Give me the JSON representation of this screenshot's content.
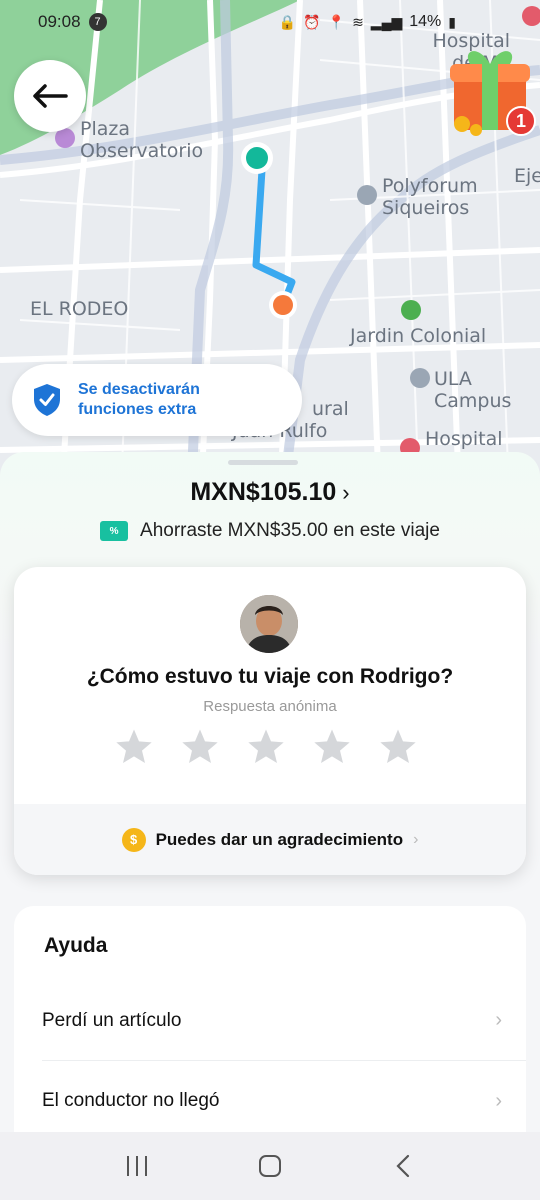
{
  "status_bar": {
    "time": "09:08",
    "notification_count": "7",
    "battery": "14%"
  },
  "map": {
    "labels": {
      "plaza": "Plaza\nObservatorio",
      "polyforum": "Polyforum\nSiqueiros",
      "el_rodeo": "EL RODEO",
      "jardin": "Jardin Colonial",
      "ula": "ULA Campus",
      "hospital_top": "Hospital\nde Mé",
      "hospital_angel": "Hospital Ange",
      "eje": "Eje",
      "cultural": "ural",
      "rulfo": "Juan Rulfo"
    },
    "route_color": "#3aa9f0",
    "origin_color": "#13b89a",
    "destination_color": "#f5793b"
  },
  "gift": {
    "badge": "1"
  },
  "banner": {
    "text": "Se desactivarán\nfunciones extra"
  },
  "trip": {
    "price": "MXN$105.10",
    "price_chevron": "›",
    "savings_icon": "%",
    "savings": "Ahorraste MXN$35.00 en este viaje"
  },
  "rating": {
    "question": "¿Cómo estuvo tu viaje con Rodrigo?",
    "subtitle": "Respuesta anónima",
    "star_count": 5,
    "thanks": "Puedes dar un agradecimiento",
    "thanks_icon": "$"
  },
  "help": {
    "title": "Ayuda",
    "items": [
      {
        "label": "Perdí un artículo"
      },
      {
        "label": "El conductor no llegó"
      }
    ]
  },
  "colors": {
    "accent_blue": "#1e74d6",
    "coupon_teal": "#18c0a0",
    "coin_yellow": "#f5b619",
    "star_gray": "#d5d7da"
  }
}
